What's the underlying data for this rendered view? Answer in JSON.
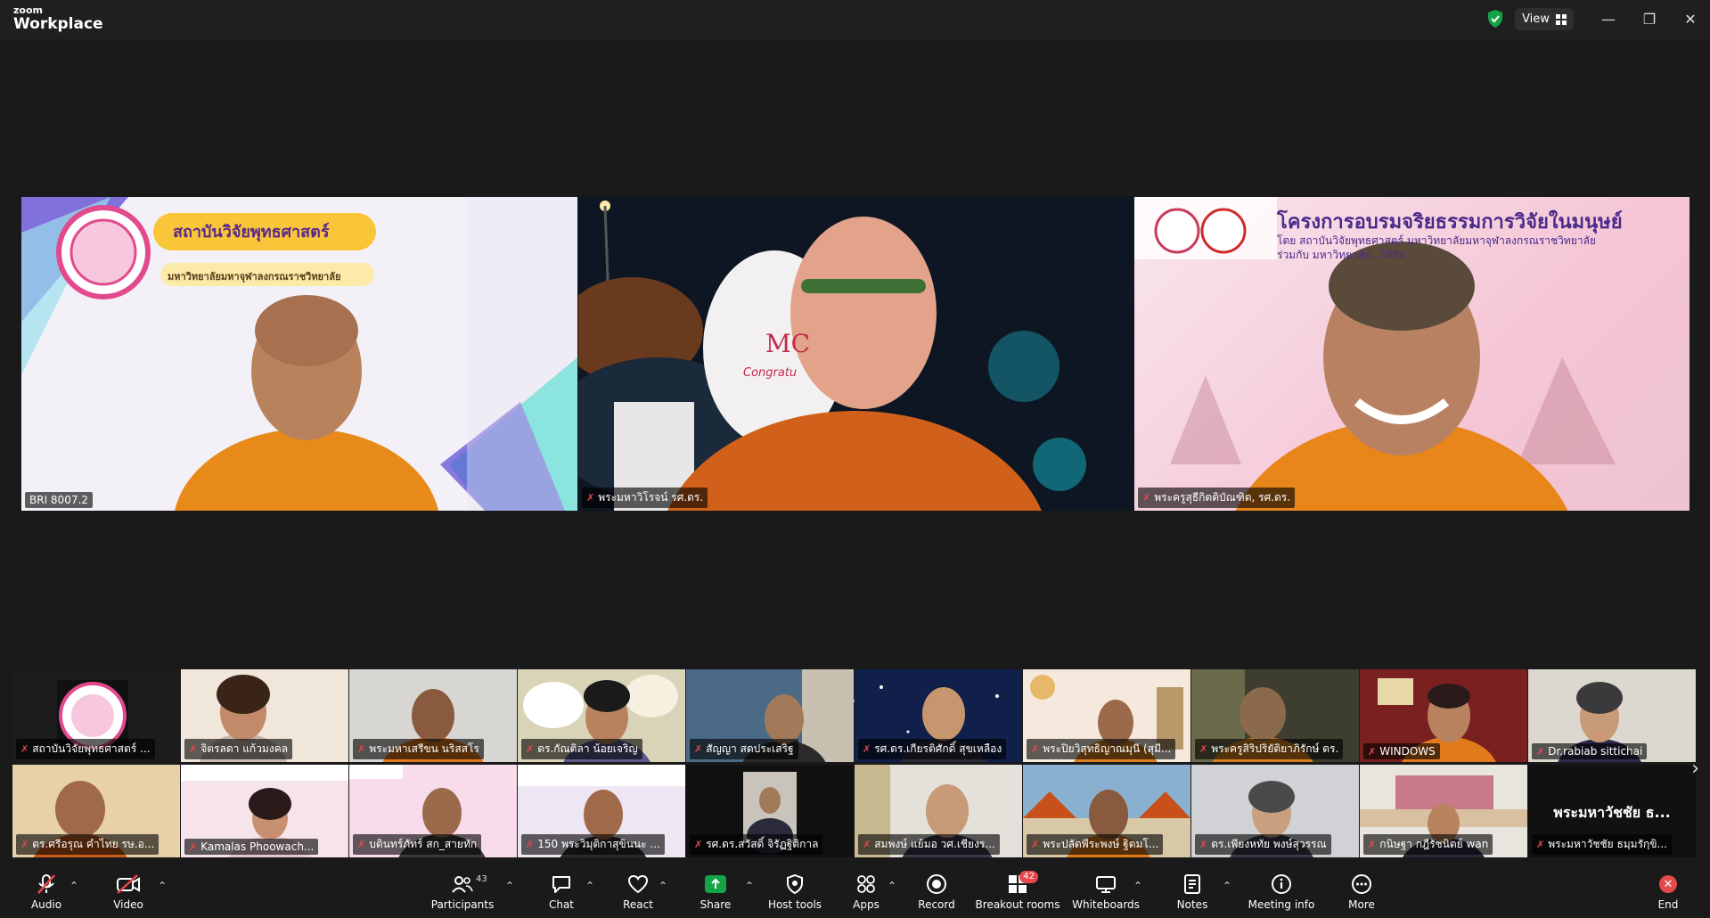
{
  "app": {
    "brand_small": "zoom",
    "brand_large": "Workplace"
  },
  "titlebar": {
    "view_label": "View"
  },
  "speakers": [
    {
      "name": "BRI 8007.2",
      "muted": false,
      "slide_title": "สถาบันวิจัยพุทธศาสตร์",
      "slide_subtitle": "มหาวิทยาลัยมหาจุฬาลงกรณราชวิทยาลัย"
    },
    {
      "name": "พระมหาวิโรจน์ รศ.ดร.",
      "muted": true,
      "backdrop_text": "MC",
      "backdrop_sub": "Congratu"
    },
    {
      "name": "พระครูสุธีกิตติบัณฑิต, รศ.ดร.",
      "muted": true,
      "banner_title": "โครงการอบรมจริยธรรมการวิจัยในมนุษย์",
      "banner_line1": "โดย สถาบันวิจัยพุทธศาสตร์ มหาวิทยาลัยมหาจุฬาลงกรณราชวิทยาลัย",
      "banner_line2": "ร่วมกับ มหาวิทยาลัย...ได้รับ"
    }
  ],
  "thumbnails_row1": [
    {
      "name": "สถาบันวิจัยพุทธศาสตร์ ..."
    },
    {
      "name": "จิตรลดา แก้วมงคล"
    },
    {
      "name": "พระมหาเสรีขน นริสสโร"
    },
    {
      "name": "ดร.กัณติลา น้อยเจริญ"
    },
    {
      "name": "สัญญา สดประเสริฐ"
    },
    {
      "name": "รศ.ดร.เกียรติศักดิ์ สุขเหลือง"
    },
    {
      "name": "พระปิยวิสุทธิญาณมุนี (สุมี..."
    },
    {
      "name": "พระครูสิริปริยัติยาภิรักษ์ ดร."
    },
    {
      "name": "WINDOWS"
    },
    {
      "name": "Dr.rabiab sittichai"
    }
  ],
  "thumbnails_row2": [
    {
      "name": "ดร.ศรีอรุณ คำไทย รษ.อ..."
    },
    {
      "name": "Kamalas Phoowach..."
    },
    {
      "name": "บดินทร์ภัทร์ สก_สายทัก"
    },
    {
      "name": "150 พระวิมุติกาสุขินนะ ..."
    },
    {
      "name": "รศ.ดร.สวัสดิ์ จิรัฏฐิติกาล"
    },
    {
      "name": "สมพงษ์ แย้มอ วศ.เชียงร..."
    },
    {
      "name": "พระปลัดพีระพงษ์ ฐิตมโ..."
    },
    {
      "name": "ดร.เพียงหทัย พงษ์สุวรรณ"
    },
    {
      "name": "กนิษฐา กฎีรัชนิตย์ wan"
    },
    {
      "name": "พระมหาวัชชัย ธมฺมรักฺขิ...",
      "display_text": "พระมหาวัชชัย ธ..."
    }
  ],
  "toolbar": {
    "audio": "Audio",
    "video": "Video",
    "participants": "Participants",
    "participants_count": "43",
    "chat": "Chat",
    "react": "React",
    "share": "Share",
    "host_tools": "Host tools",
    "apps": "Apps",
    "record": "Record",
    "breakout": "Breakout rooms",
    "breakout_count": "42",
    "whiteboards": "Whiteboards",
    "notes": "Notes",
    "meeting_info": "Meeting info",
    "more": "More",
    "end": "End"
  },
  "colors": {
    "accent_share": "#15a347",
    "danger": "#e5484d",
    "background": "#1a1a1a"
  },
  "icons": [
    "shield-check-icon",
    "grid-icon",
    "minimize-icon",
    "maximize-icon",
    "close-icon",
    "mic-muted-icon",
    "video-off-icon",
    "participants-icon",
    "chat-icon",
    "react-icon",
    "share-icon",
    "host-tools-icon",
    "apps-icon",
    "record-icon",
    "breakout-icon",
    "whiteboard-icon",
    "notes-icon",
    "info-icon",
    "more-icon",
    "end-icon",
    "chevron-right-icon"
  ]
}
